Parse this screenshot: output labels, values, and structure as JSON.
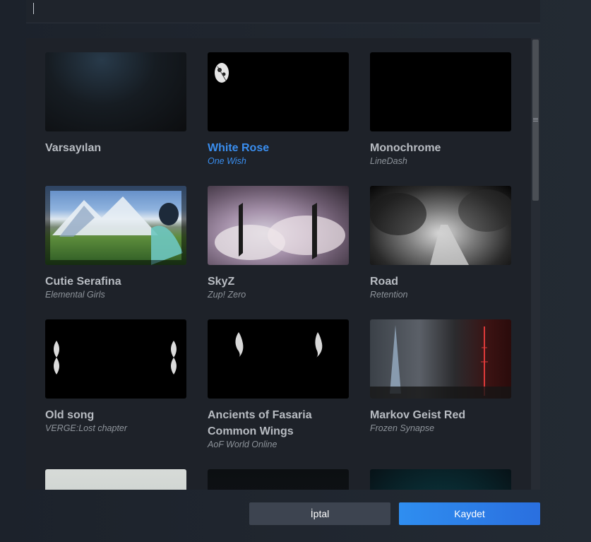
{
  "search": {
    "value": ""
  },
  "themes": [
    {
      "title": "Varsayılan",
      "subtitle": []
    },
    {
      "title": "White Rose",
      "subtitle": [
        "One Wish"
      ],
      "selected": true
    },
    {
      "title": "Monochrome",
      "subtitle": [
        "LineDash"
      ]
    },
    {
      "title": "Cutie Serafina",
      "subtitle": [
        "Elemental Girls"
      ]
    },
    {
      "title": "SkyZ",
      "subtitle": [
        "Zup! Zero"
      ]
    },
    {
      "title": "Road",
      "subtitle": [
        "Retention"
      ]
    },
    {
      "title": "Old song",
      "subtitle": [
        "VERGE:Lost chapter"
      ]
    },
    {
      "title": "Ancients of Fasaria Common Wings",
      "title_lines": [
        "Ancients of Fasaria",
        "Common Wings"
      ],
      "subtitle": [
        "AoF World Online"
      ]
    },
    {
      "title": "Markov Geist Red",
      "subtitle": [
        "Frozen Synapse"
      ]
    }
  ],
  "buttons": {
    "cancel": "İptal",
    "save": "Kaydet"
  },
  "colors": {
    "accent": "#3a8eef",
    "save_button": "#2f8ef0",
    "cancel_button": "#3d4450"
  }
}
